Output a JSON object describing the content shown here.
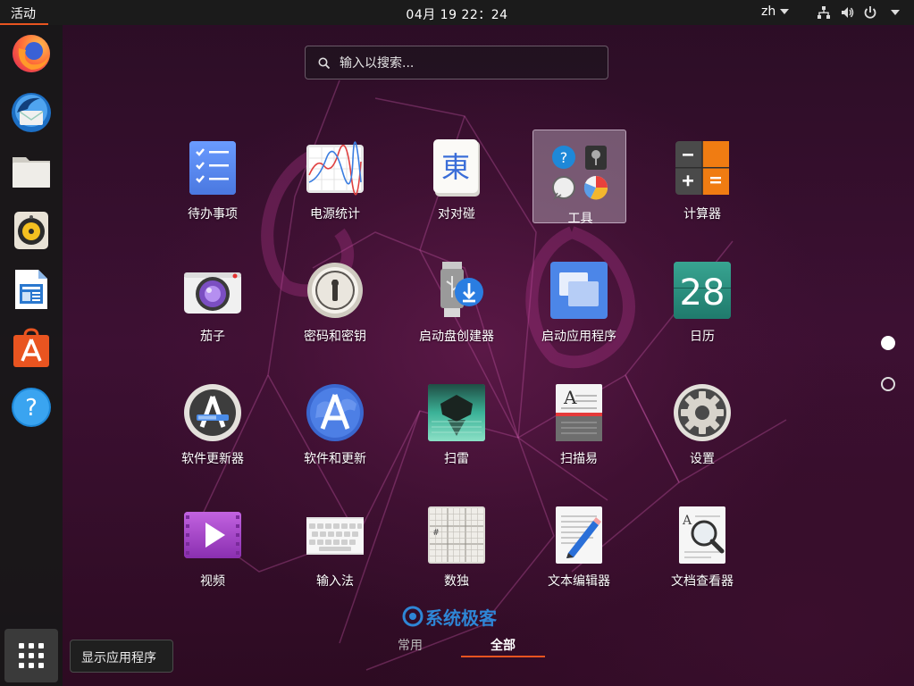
{
  "topbar": {
    "activities_label": "活动",
    "clock": "04月 19  22：24",
    "lang": "zh",
    "network_icon": "network-icon",
    "volume_icon": "volume-icon",
    "power_icon": "power-icon"
  },
  "dock": {
    "items": [
      {
        "name": "Firefox",
        "icon": "firefox-icon"
      },
      {
        "name": "Thunderbird",
        "icon": "thunderbird-icon"
      },
      {
        "name": "Files",
        "icon": "files-icon"
      },
      {
        "name": "Rhythmbox",
        "icon": "rhythmbox-icon"
      },
      {
        "name": "LibreOffice Writer",
        "icon": "writer-icon"
      },
      {
        "name": "Ubuntu Software",
        "icon": "software-icon"
      },
      {
        "name": "Help",
        "icon": "help-icon"
      }
    ],
    "show_apps_tooltip": "显示应用程序"
  },
  "search": {
    "placeholder": "输入以搜索..."
  },
  "apps": [
    {
      "label": "待办事项",
      "icon": "todo-icon"
    },
    {
      "label": "电源统计",
      "icon": "power-stats-icon"
    },
    {
      "label": "对对碰",
      "icon": "mahjongg-icon"
    },
    {
      "label": "工具",
      "icon": "folder-icon"
    },
    {
      "label": "计算器",
      "icon": "calculator-icon"
    },
    {
      "label": "茄子",
      "icon": "cheese-icon"
    },
    {
      "label": "密码和密钥",
      "icon": "keyring-icon"
    },
    {
      "label": "启动盘创建器",
      "icon": "usb-creator-icon"
    },
    {
      "label": "启动应用程序",
      "icon": "startup-apps-icon"
    },
    {
      "label": "日历",
      "icon": "calendar-icon"
    },
    {
      "label": "软件更新器",
      "icon": "software-updater-icon"
    },
    {
      "label": "软件和更新",
      "icon": "software-properties-icon"
    },
    {
      "label": "扫雷",
      "icon": "mines-icon"
    },
    {
      "label": "扫描易",
      "icon": "scanner-icon"
    },
    {
      "label": "设置",
      "icon": "settings-icon"
    },
    {
      "label": "视频",
      "icon": "videos-icon"
    },
    {
      "label": "输入法",
      "icon": "keyboard-icon"
    },
    {
      "label": "数独",
      "icon": "sudoku-icon"
    },
    {
      "label": "文本编辑器",
      "icon": "text-editor-icon"
    },
    {
      "label": "文档查看器",
      "icon": "document-viewer-icon"
    }
  ],
  "calendar_day": "28",
  "mahjongg_glyph": "東",
  "pages": {
    "current": 1,
    "total": 2
  },
  "tabs": {
    "frequent": "常用",
    "all": "全部",
    "active": "全部"
  },
  "watermark": "系统极客",
  "colors": {
    "accent": "#e95420",
    "topbar": "#1b1b1b",
    "dock": "#181818"
  }
}
